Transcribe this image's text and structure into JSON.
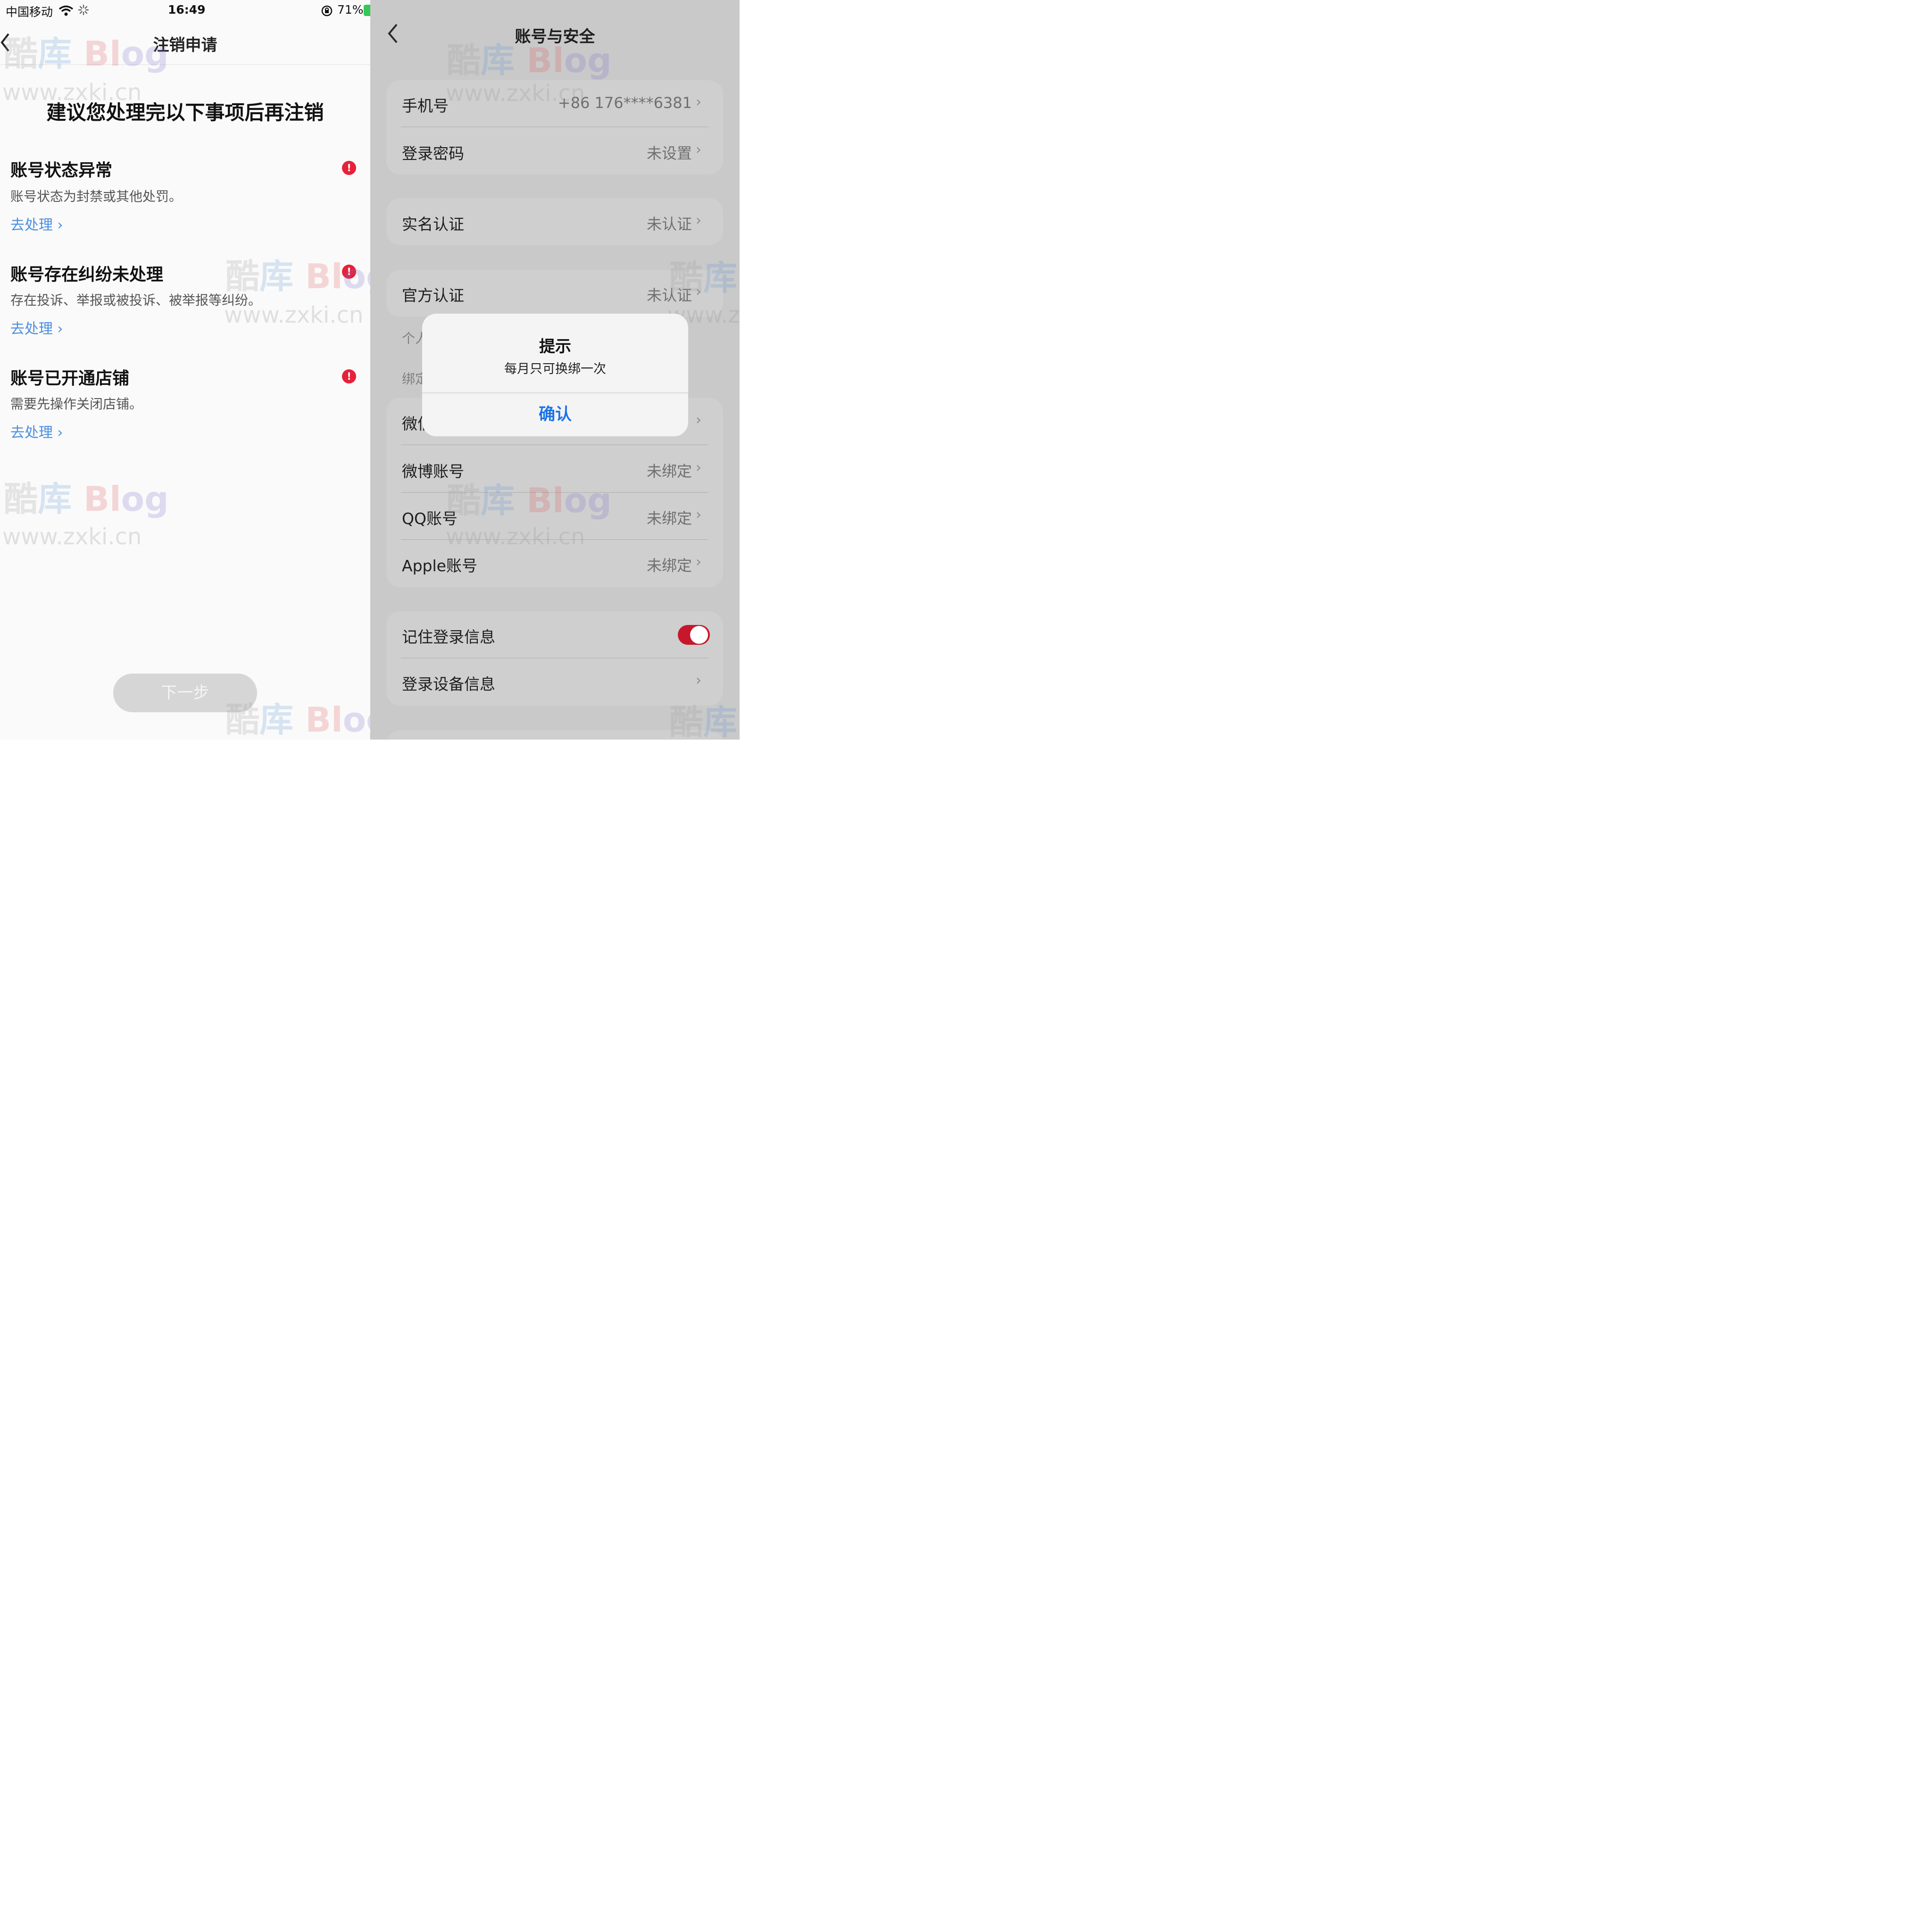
{
  "left": {
    "status": {
      "carrier": "中国移动",
      "time": "16:49",
      "battery": "71%"
    },
    "nav": {
      "title": "注销申请"
    },
    "headline": "建议您处理完以下事项后再注销",
    "items": [
      {
        "title": "账号状态异常",
        "desc": "账号状态为封禁或其他处罚。",
        "link": "去处理 ›"
      },
      {
        "title": "账号存在纠纷未处理",
        "desc": "存在投诉、举报或被投诉、被举报等纠纷。",
        "link": "去处理 ›"
      },
      {
        "title": "账号已开通店铺",
        "desc": "需要先操作关闭店铺。",
        "link": "去处理 ›"
      }
    ],
    "warn_glyph": "!",
    "next_button": "下一步"
  },
  "right": {
    "nav": {
      "title": "账号与安全"
    },
    "rows": {
      "phone": {
        "label": "手机号",
        "value": "+86 176****6381"
      },
      "password": {
        "label": "登录密码",
        "value": "未设置"
      },
      "realname": {
        "label": "实名认证",
        "value": "未认证"
      },
      "official": {
        "label": "官方认证",
        "value": "未认证"
      },
      "wechat": {
        "label": "微信"
      },
      "weibo": {
        "label": "微博账号",
        "value": "未绑定"
      },
      "qq": {
        "label": "QQ账号",
        "value": "未绑定"
      },
      "apple": {
        "label": "Apple账号",
        "value": "未绑定"
      },
      "remember": {
        "label": "记住登录信息",
        "on": true
      },
      "devices": {
        "label": "登录设备信息"
      }
    },
    "partial_labels": {
      "personal": "个人",
      "bind": "绑定"
    },
    "dialog": {
      "title": "提示",
      "message": "每月只可换绑一次",
      "confirm": "确认"
    },
    "chevron": "›"
  },
  "watermark": {
    "brand_a": "酷",
    "brand_b": "库",
    "brand_c": "Bl",
    "brand_d": "og",
    "url": "www.zxki.cn"
  },
  "colors": {
    "accent_red": "#e8203a",
    "link_blue": "#4a8ee0",
    "dialog_blue": "#1a73e8"
  }
}
